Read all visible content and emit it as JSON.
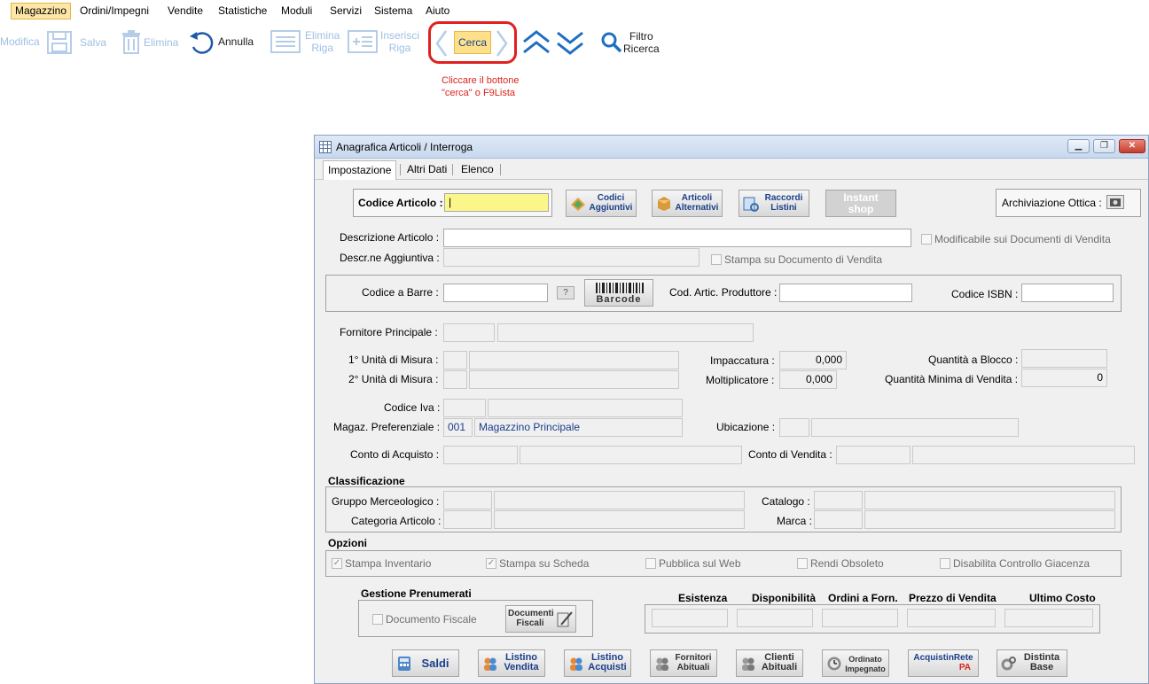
{
  "menu": {
    "items": [
      "Magazzino",
      "Ordini/Impegni",
      "Vendite",
      "Statistiche",
      "Moduli",
      "Servizi",
      "Sistema",
      "Aiuto"
    ]
  },
  "toolbar": {
    "modifica": "Modifica",
    "salva": "Salva",
    "elimina": "Elimina",
    "annulla": "Annulla",
    "elimina_riga": [
      "Elimina",
      "Riga"
    ],
    "inserisci_riga": [
      "Inserisci",
      "Riga"
    ],
    "cerca": "Cerca",
    "filtro_ricerca": [
      "Filtro",
      "Ricerca"
    ]
  },
  "hint": [
    "Cliccare il bottone",
    "\"cerca\" o F9Lista"
  ],
  "window": {
    "title": "Anagrafica Articoli / Interroga",
    "controls": [
      "▁",
      "❐",
      "✕"
    ],
    "tabs": [
      "Impostazione",
      "Altri Dati",
      "Elenco"
    ]
  },
  "form": {
    "codice_articolo_label": "Codice Articolo :",
    "buttons_top": {
      "codici_aggiuntivi": [
        "Codici",
        "Aggiuntivi"
      ],
      "articoli_alternativi": [
        "Articoli",
        "Alternativi"
      ],
      "raccordi_listini": [
        "Raccordi",
        "Listini"
      ],
      "instant_shop": [
        "Instant",
        "shop"
      ]
    },
    "archiviazione_ottica": "Archiviazione Ottica :",
    "descrizione_articolo": "Descrizione Articolo :",
    "descr_aggiuntiva": "Descr.ne Aggiuntiva :",
    "modificabile": "Modificabile sui Documenti di Vendita",
    "stampa_documento": "Stampa su Documento di Vendita",
    "codice_barre": "Codice a Barre :",
    "question": "?",
    "barcode_btn": "Barcode",
    "cod_produttore": "Cod. Artic. Produttore :",
    "codice_isbn": "Codice ISBN :",
    "fornitore_principale": "Fornitore Principale :",
    "um1": "1° Unità di Misura :",
    "um2": "2° Unità di Misura :",
    "impaccatura": "Impaccatura :",
    "impaccatura_val": "0,000",
    "moltiplicatore": "Moltiplicatore :",
    "moltiplicatore_val": "0,000",
    "qta_blocco": "Quantità a Blocco :",
    "qta_minima": "Quantità Minima di Vendita :",
    "qta_minima_val": "0",
    "codice_iva": "Codice Iva :",
    "magaz_pref": "Magaz. Preferenziale :",
    "magaz_code": "001",
    "magaz_name": "Magazzino Principale",
    "ubicazione": "Ubicazione :",
    "conto_acquisto": "Conto di Acquisto :",
    "conto_vendita": "Conto di Vendita :",
    "classificazione": "Classificazione",
    "gruppo_merceologico": "Gruppo Merceologico :",
    "categoria_articolo": "Categoria Articolo :",
    "catalogo": "Catalogo :",
    "marca": "Marca :",
    "opzioni": "Opzioni",
    "opt_stampa_inventario": "Stampa Inventario",
    "opt_stampa_scheda": "Stampa su Scheda",
    "opt_pubblica_web": "Pubblica sul Web",
    "opt_rendi_obsoleto": "Rendi Obsoleto",
    "opt_disabilita": "Disabilita Controllo Giacenza",
    "check_mark": "✓",
    "gestione_prenumerati": "Gestione Prenumerati",
    "documento_fiscale": "Documento Fiscale",
    "documenti_fiscali_btn": [
      "Documenti",
      "Fiscali"
    ],
    "stats_headers": [
      "Esistenza",
      "Disponibilità",
      "Ordini a Forn.",
      "Prezzo di Vendita",
      "Ultimo Costo"
    ]
  },
  "bottom_buttons": {
    "saldi": "Saldi",
    "listino_vendita": [
      "Listino",
      "Vendita"
    ],
    "listino_acquisti": [
      "Listino",
      "Acquisti"
    ],
    "fornitori_abituali": [
      "Fornitori",
      "Abituali"
    ],
    "clienti_abituali": [
      "Clienti",
      "Abituali"
    ],
    "ordinato_impegnato": [
      "Ordinato",
      "Impegnato"
    ],
    "acquisti_in_rete": [
      "AcquistinRete",
      "PA"
    ],
    "distinta_base": [
      "Distinta",
      "Base"
    ]
  },
  "colors": {
    "accent_highlight": "#e02020",
    "hint_text": "#d9251d",
    "yellow_field": "#fbf68a",
    "toolbar_disabled": "#9fbfe2"
  }
}
